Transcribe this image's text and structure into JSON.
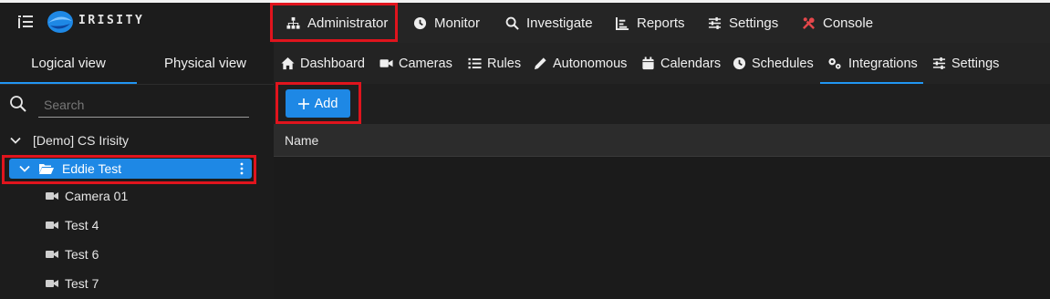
{
  "brand": {
    "name": "IRISITY"
  },
  "topnav": {
    "items": [
      {
        "label": "Administrator",
        "icon": "sitemap-icon"
      },
      {
        "label": "Monitor",
        "icon": "clock-icon"
      },
      {
        "label": "Investigate",
        "icon": "search-icon"
      },
      {
        "label": "Reports",
        "icon": "chart-icon"
      },
      {
        "label": "Settings",
        "icon": "sliders-icon"
      },
      {
        "label": "Console",
        "icon": "tools-icon"
      }
    ]
  },
  "sidebar": {
    "tabs": [
      {
        "label": "Logical view"
      },
      {
        "label": "Physical view"
      }
    ],
    "active_tab": "Logical view",
    "search": {
      "placeholder": "Search",
      "value": ""
    },
    "tree": {
      "root": {
        "label": "[Demo] CS Irisity",
        "expanded": true
      },
      "selected": {
        "label": "Eddie Test",
        "expanded": true
      },
      "children": [
        {
          "label": "Camera 01"
        },
        {
          "label": "Test 4"
        },
        {
          "label": "Test 6"
        },
        {
          "label": "Test 7"
        }
      ]
    }
  },
  "subnav": {
    "items": [
      {
        "label": "Dashboard",
        "icon": "home-icon"
      },
      {
        "label": "Cameras",
        "icon": "video-camera-icon"
      },
      {
        "label": "Rules",
        "icon": "list-icon"
      },
      {
        "label": "Autonomous",
        "icon": "pencil-icon"
      },
      {
        "label": "Calendars",
        "icon": "calendar-icon"
      },
      {
        "label": "Schedules",
        "icon": "clock-icon"
      },
      {
        "label": "Integrations",
        "icon": "gears-icon"
      },
      {
        "label": "Settings",
        "icon": "sliders-icon"
      }
    ],
    "active": "Integrations"
  },
  "toolbar": {
    "add_label": "Add"
  },
  "table": {
    "columns": [
      {
        "label": "Name"
      }
    ],
    "rows": []
  },
  "colors": {
    "accent": "#1e88e5",
    "highlight": "#e0141d",
    "console_icon": "#e5474b"
  }
}
